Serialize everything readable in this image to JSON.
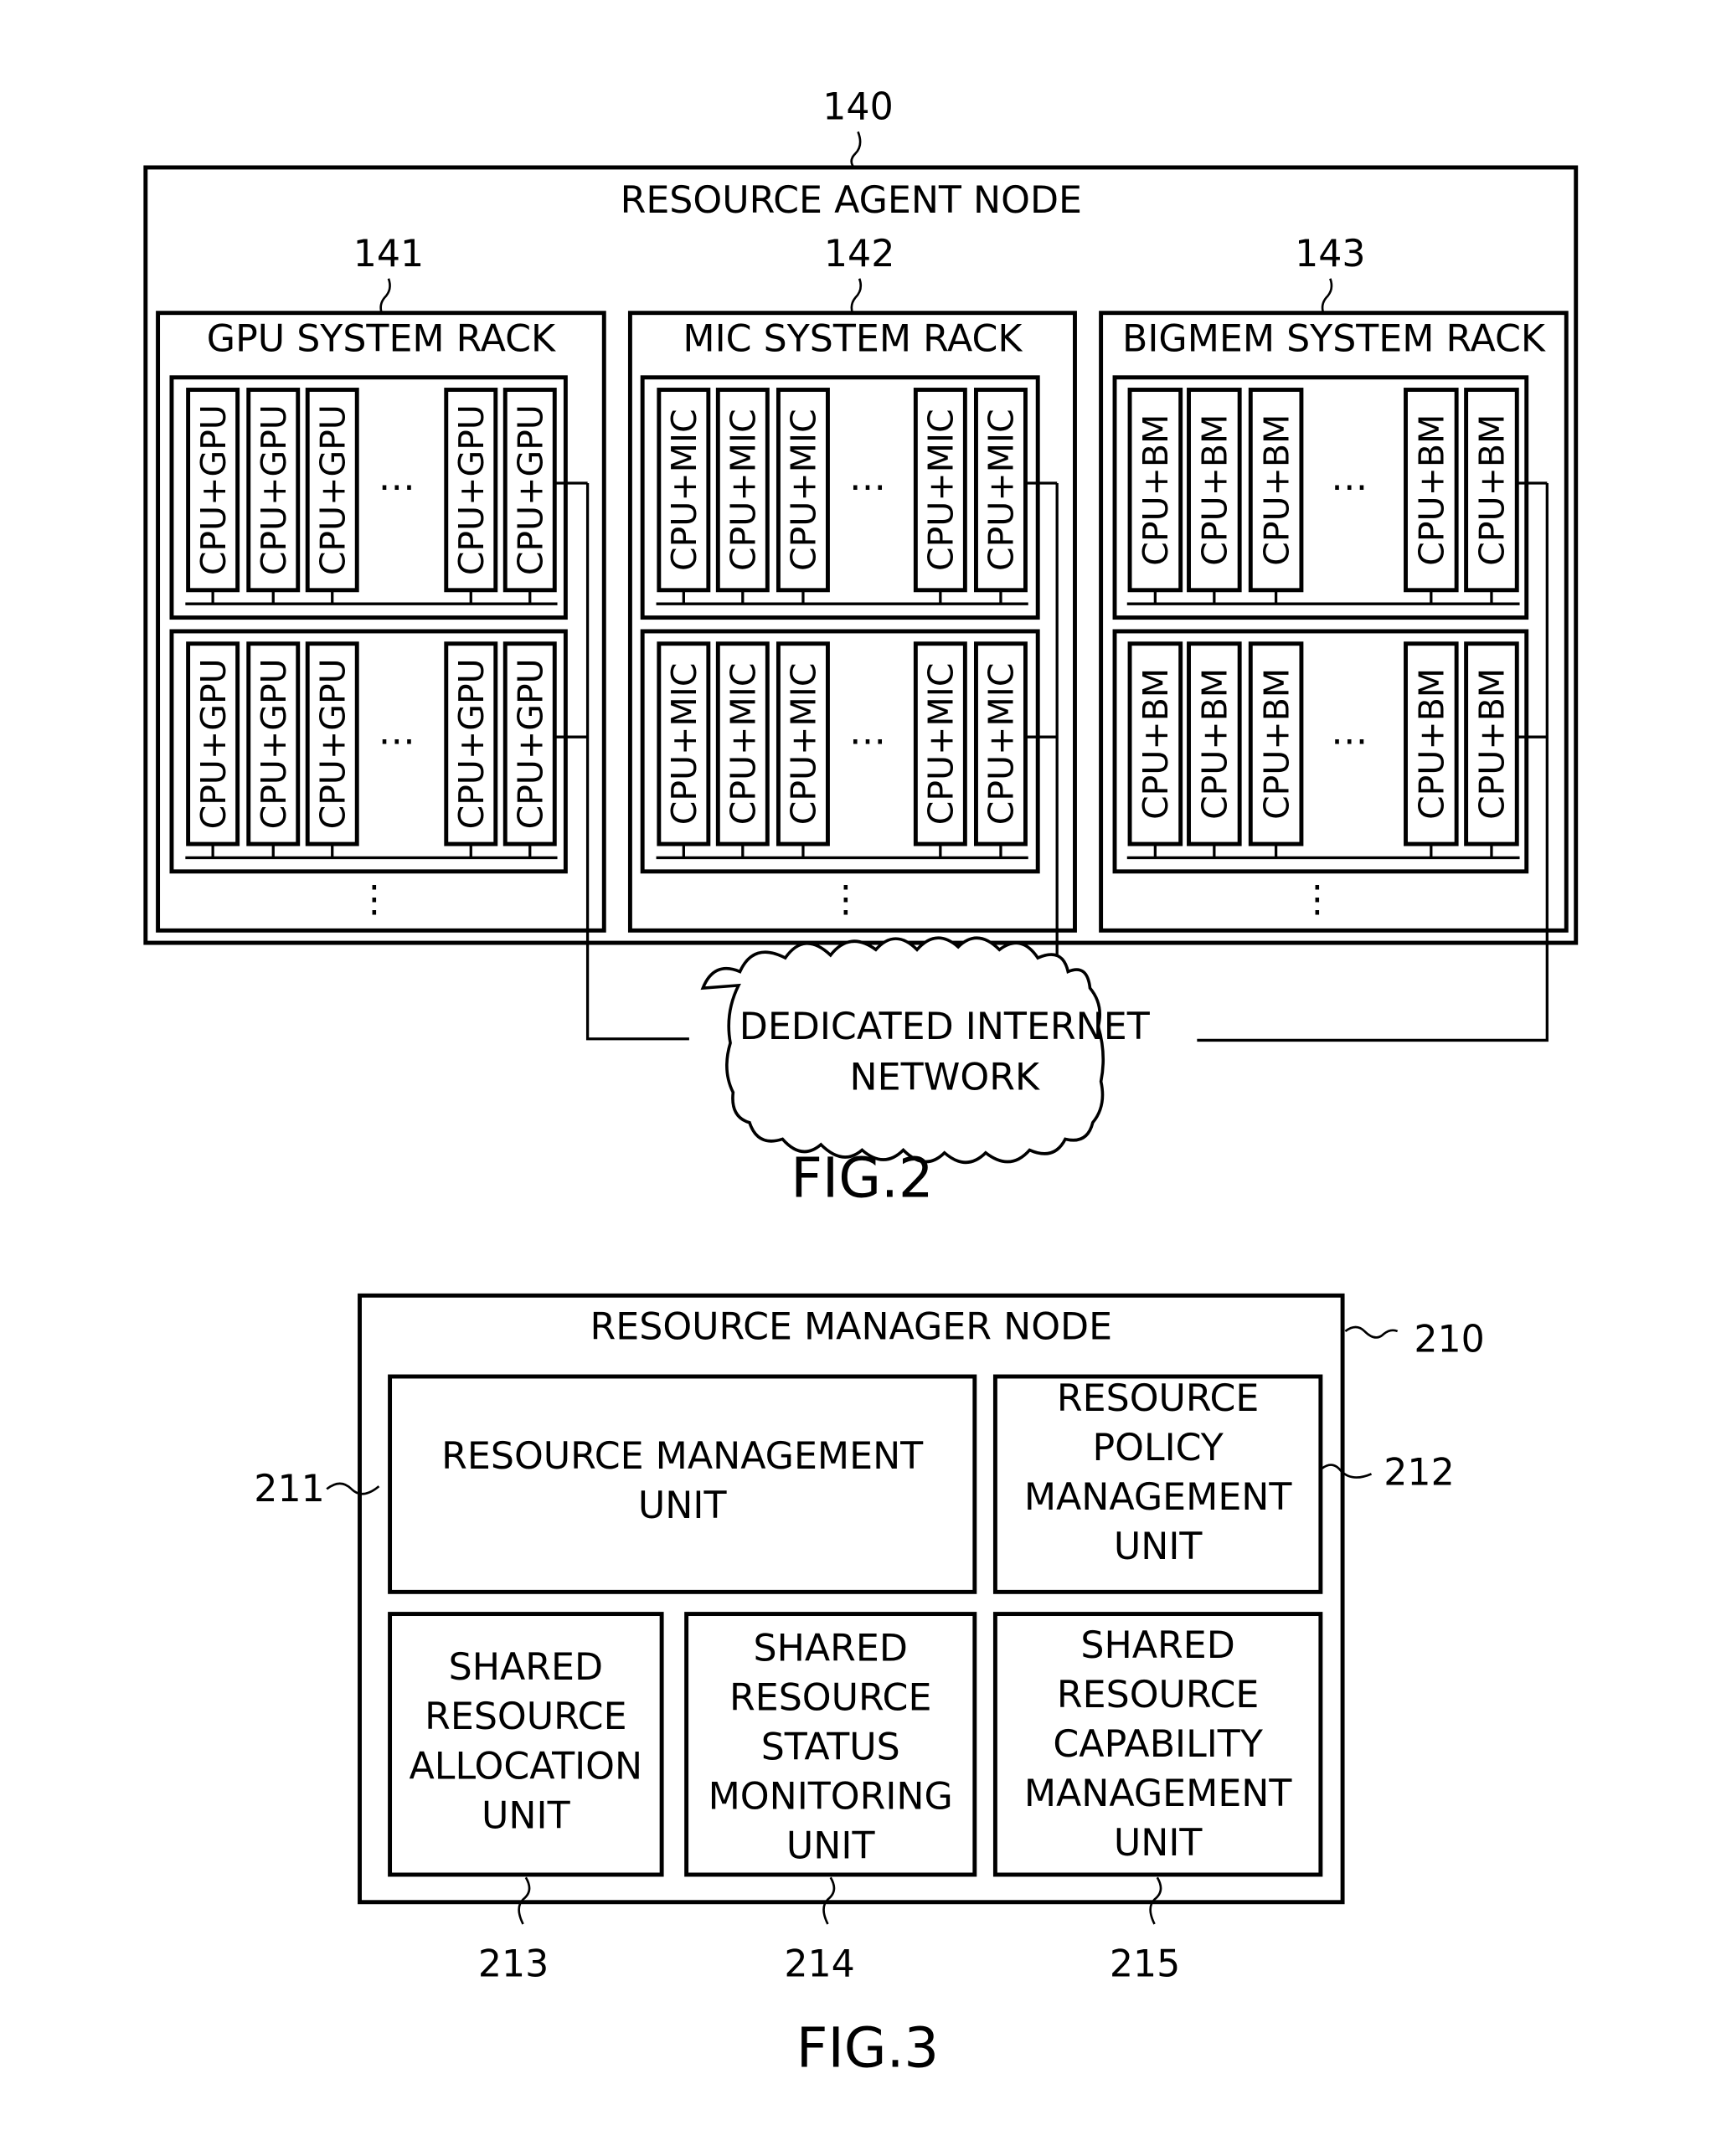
{
  "fig2": {
    "caption": "FIG.2",
    "node": {
      "ref": "140",
      "title": "RESOURCE AGENT NODE"
    },
    "racks": [
      {
        "ref": "141",
        "title": "GPU SYSTEM RACK",
        "card_label": "CPU+GPU"
      },
      {
        "ref": "142",
        "title": "MIC SYSTEM RACK",
        "card_label": "CPU+MIC"
      },
      {
        "ref": "143",
        "title": "BIGMEM SYSTEM RACK",
        "card_label": "CPU+BM"
      }
    ],
    "ellipsis_h": "…",
    "ellipsis_v": "⋮",
    "network": {
      "line1": "DEDICATED INTERNET",
      "line2": "NETWORK"
    }
  },
  "fig3": {
    "caption": "FIG.3",
    "node": {
      "ref": "210",
      "title": "RESOURCE MANAGER NODE"
    },
    "units": [
      {
        "ref": "211",
        "lines": [
          "RESOURCE MANAGEMENT",
          "UNIT"
        ]
      },
      {
        "ref": "212",
        "lines": [
          "RESOURCE",
          "POLICY",
          "MANAGEMENT",
          "UNIT"
        ]
      },
      {
        "ref": "213",
        "lines": [
          "SHARED",
          "RESOURCE",
          "ALLOCATION",
          "UNIT"
        ]
      },
      {
        "ref": "214",
        "lines": [
          "SHARED",
          "RESOURCE",
          "STATUS",
          "MONITORING",
          "UNIT"
        ]
      },
      {
        "ref": "215",
        "lines": [
          "SHARED",
          "RESOURCE",
          "CAPABILITY",
          "MANAGEMENT",
          "UNIT"
        ]
      }
    ]
  }
}
